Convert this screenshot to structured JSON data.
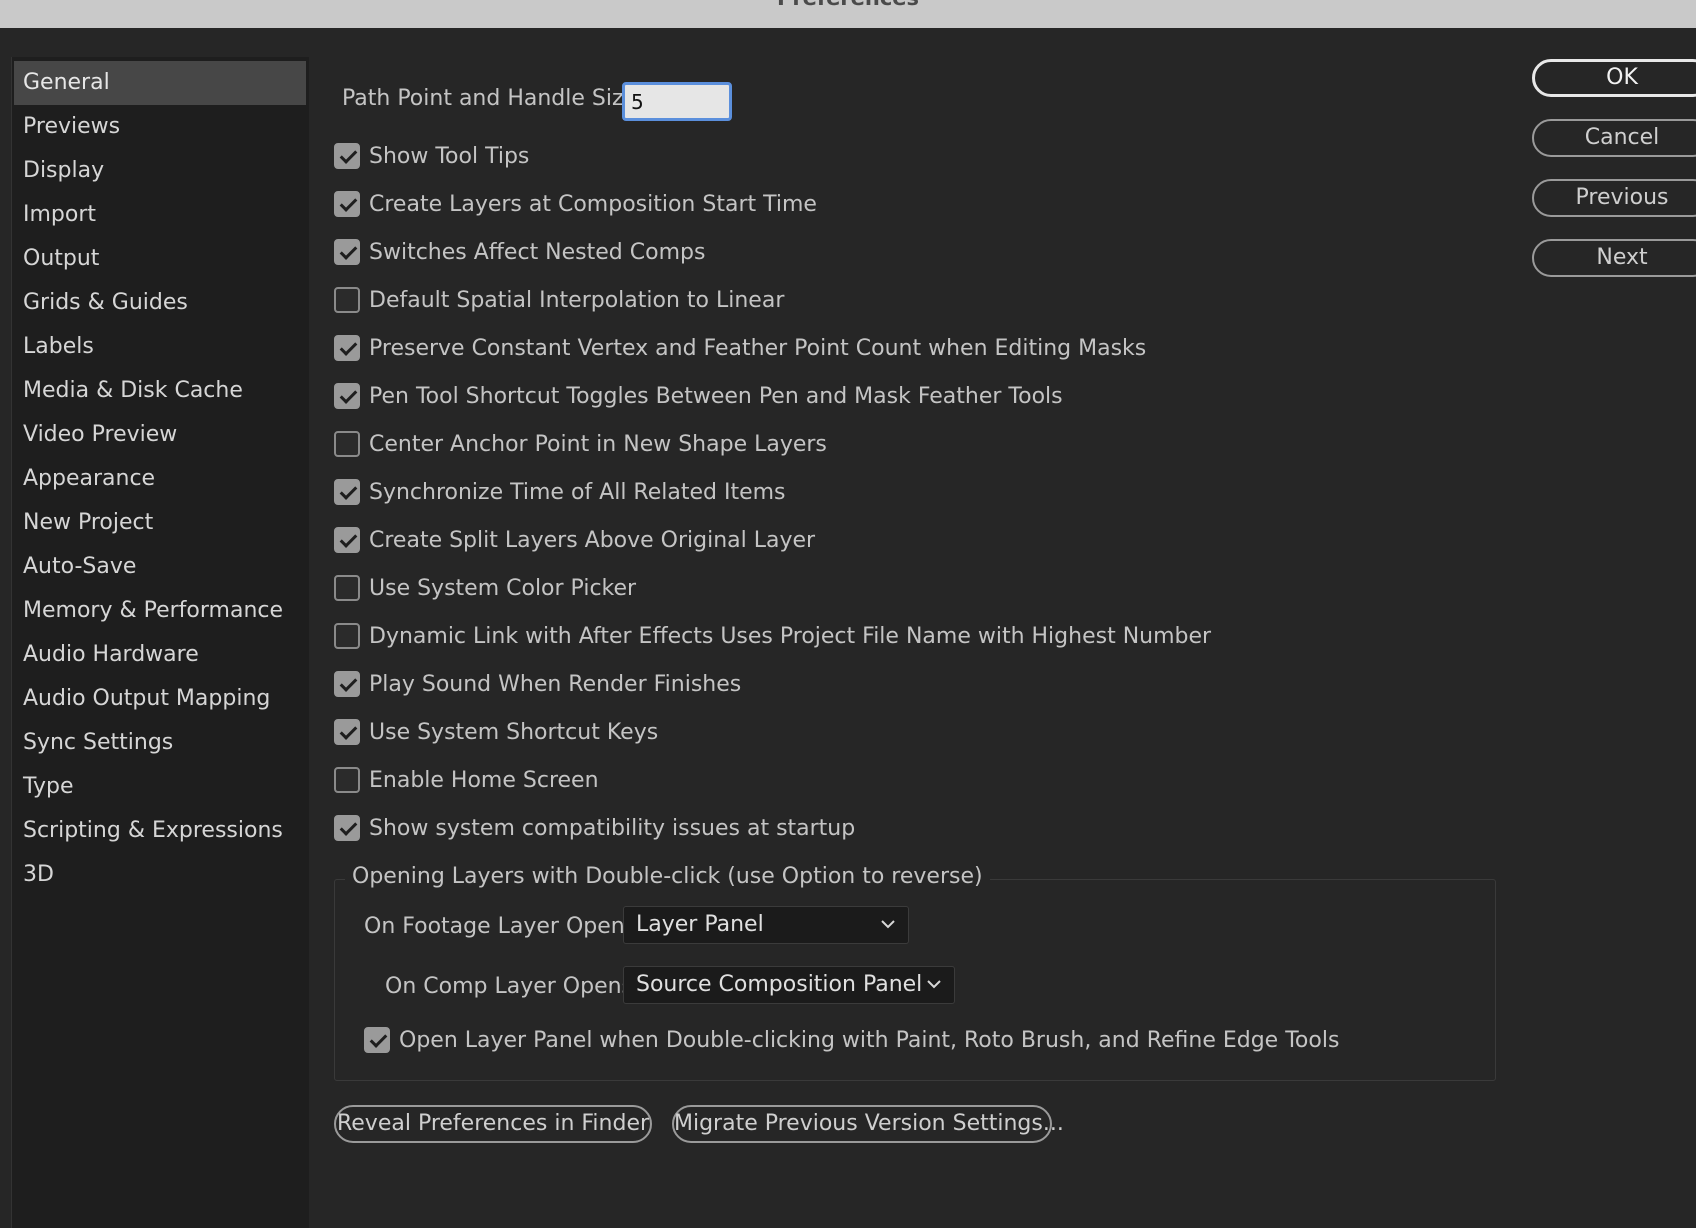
{
  "window": {
    "title": "Preferences"
  },
  "sidebar": {
    "items": [
      {
        "label": "General",
        "selected": true
      },
      {
        "label": "Previews"
      },
      {
        "label": "Display"
      },
      {
        "label": "Import"
      },
      {
        "label": "Output"
      },
      {
        "label": "Grids & Guides"
      },
      {
        "label": "Labels"
      },
      {
        "label": "Media & Disk Cache"
      },
      {
        "label": "Video Preview"
      },
      {
        "label": "Appearance"
      },
      {
        "label": "New Project"
      },
      {
        "label": "Auto-Save"
      },
      {
        "label": "Memory & Performance"
      },
      {
        "label": "Audio Hardware"
      },
      {
        "label": "Audio Output Mapping"
      },
      {
        "label": "Sync Settings"
      },
      {
        "label": "Type"
      },
      {
        "label": "Scripting & Expressions"
      },
      {
        "label": "3D"
      }
    ]
  },
  "general": {
    "path_point_label": "Path Point and Handle Size:",
    "path_point_value": "5",
    "options": [
      {
        "label": "Show Tool Tips",
        "checked": true
      },
      {
        "label": "Create Layers at Composition Start Time",
        "checked": true
      },
      {
        "label": "Switches Affect Nested Comps",
        "checked": true
      },
      {
        "label": "Default Spatial Interpolation to Linear",
        "checked": false
      },
      {
        "label": "Preserve Constant Vertex and Feather Point Count when Editing Masks",
        "checked": true
      },
      {
        "label": "Pen Tool Shortcut Toggles Between Pen and Mask Feather Tools",
        "checked": true
      },
      {
        "label": "Center Anchor Point in New Shape Layers",
        "checked": false
      },
      {
        "label": "Synchronize Time of All Related Items",
        "checked": true
      },
      {
        "label": "Create Split Layers Above Original Layer",
        "checked": true
      },
      {
        "label": "Use System Color Picker",
        "checked": false
      },
      {
        "label": "Dynamic Link with After Effects Uses Project File Name with Highest Number",
        "checked": false
      },
      {
        "label": "Play Sound When Render Finishes",
        "checked": true
      },
      {
        "label": "Use System Shortcut Keys",
        "checked": true
      },
      {
        "label": "Enable Home Screen",
        "checked": false
      },
      {
        "label": "Show system compatibility issues at startup",
        "checked": true
      }
    ],
    "double_click_group": {
      "legend": "Opening Layers with Double-click (use Option to reverse)",
      "footage_label": "On Footage Layer Opens:",
      "footage_value": "Layer Panel",
      "comp_label": "On Comp Layer Opens:",
      "comp_value": "Source Composition Panel",
      "open_layer_panel_label": "Open Layer Panel when Double-clicking with Paint, Roto Brush, and Refine Edge Tools",
      "open_layer_panel_checked": true
    },
    "reveal_button": "Reveal Preferences in Finder",
    "migrate_button": "Migrate Previous Version Settings..."
  },
  "dialog_buttons": {
    "ok": "OK",
    "cancel": "Cancel",
    "previous": "Previous",
    "next": "Next"
  },
  "colors": {
    "background": "#262626",
    "sidebar": "#1e1e1e",
    "selected_item": "#474747",
    "focus_ring": "#5b8fdc"
  }
}
